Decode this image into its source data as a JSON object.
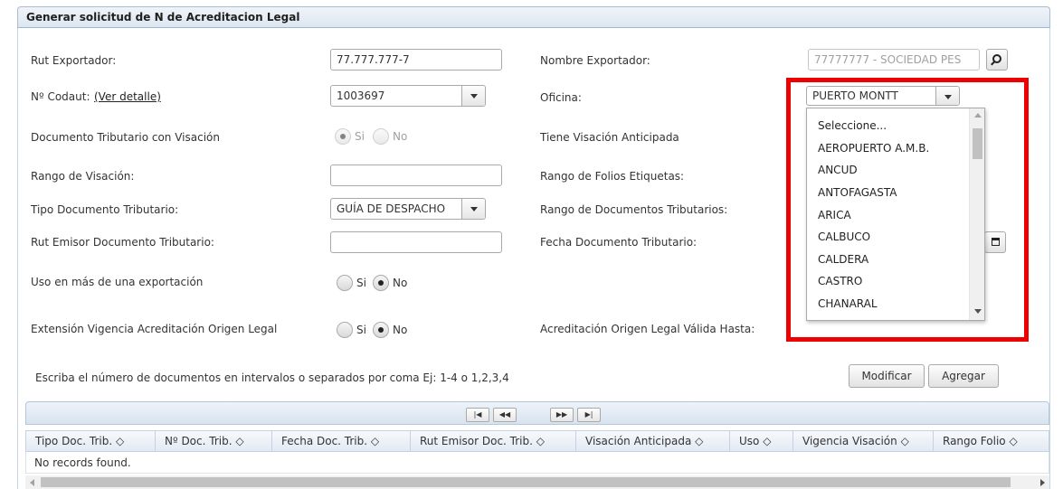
{
  "panel": {
    "title": "Generar solicitud de N de Acreditacion Legal"
  },
  "form": {
    "rut_exportador_label": "Rut Exportador:",
    "rut_exportador_value": "77.777.777-7",
    "nombre_exportador_label": "Nombre Exportador:",
    "nombre_exportador_value": "77777777 - SOCIEDAD PES",
    "codaut_label": "Nº Codaut:",
    "codaut_link": "(Ver detalle)",
    "codaut_value": "1003697",
    "oficina_label": "Oficina:",
    "oficina_value": "PUERTO MONTT",
    "doc_visacion_label": "Documento Tributario con Visación",
    "tiene_visacion_label": "Tiene Visación Anticipada",
    "rango_visacion_label": "Rango de Visación:",
    "rango_folios_label": "Rango de Folios Etiquetas:",
    "tipo_doc_label": "Tipo Documento Tributario:",
    "tipo_doc_value": "GUÍA DE DESPACHO",
    "rango_docs_label": "Rango de Documentos Tributarios:",
    "rut_emisor_label": "Rut Emisor Documento Tributario:",
    "fecha_doc_label": "Fecha Documento Tributario:",
    "uso_label": "Uso en más de una exportación",
    "extension_label": "Extensión Vigencia Acreditación Origen Legal",
    "acreditacion_label": "Acreditación Origen Legal Válida Hasta:",
    "radio_si": "Si",
    "radio_no": "No",
    "hint": "Escriba el número de documentos en intervalos o separados por coma Ej: 1-4 o 1,2,3,4"
  },
  "buttons": {
    "modificar": "Modificar",
    "agregar": "Agregar"
  },
  "oficina_options": [
    "Seleccione...",
    "AEROPUERTO A.M.B.",
    "ANCUD",
    "ANTOFAGASTA",
    "ARICA",
    "CALBUCO",
    "CALDERA",
    "CASTRO",
    "CHANARAL"
  ],
  "paginator": {
    "first": "|◀",
    "prev": "◀◀",
    "next": "▶▶",
    "last": "▶|"
  },
  "table": {
    "columns": [
      "Tipo Doc. Trib. ◇",
      "Nº Doc. Trib. ◇",
      "Fecha Doc. Trib. ◇",
      "Rut Emisor Doc. Trib. ◇",
      "Visación Anticipada ◇",
      "Uso ◇",
      "Vigencia Visación ◇",
      "Rango Folio ◇"
    ],
    "empty": "No records found."
  },
  "colors": {
    "highlight": "#ee0000",
    "header_bg": "#dce6f1"
  }
}
